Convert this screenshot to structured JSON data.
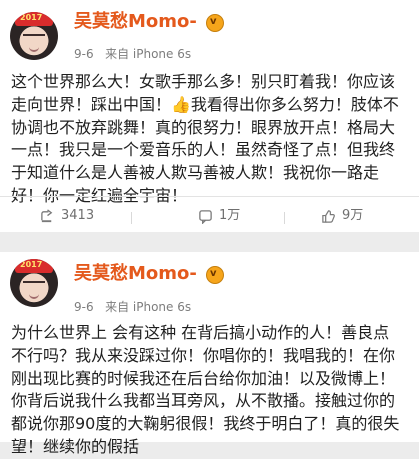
{
  "post1": {
    "user_name": "吴莫愁Momo-",
    "date": "9-6",
    "source": "来自 iPhone 6s",
    "text": "这个世界那么大！女歌手那么多！别只盯着我！你应该走向世界！踩出中国！👍我看得出你多么努力！肢体不协调也不放弃跳舞！真的很努力！眼界放开点！格局大一点！我只是一个爱音乐的人！虽然奇怪了点！但我终于知道什么是人善被人欺马善被人欺！我祝你一路走好！你一定红遍全宇宙！",
    "actions": {
      "share_count": "3413",
      "comment_count": "1万",
      "like_count": "9万"
    }
  },
  "post2": {
    "user_name": "吴莫愁Momo-",
    "date": "9-6",
    "source": "来自 iPhone 6s",
    "text": "为什么世界上 会有这种 在背后搞小动作的人！善良点不行吗？我从来没踩过你！你唱你的！我唱我的！在你刚出现比赛的时候我还在后台给你加油！以及微博上！你背后说我什么我都当耳旁风，从不散播。接触过你的都说你那90度的大鞠躬很假！我终于明白了！真的很失望！继续你的假括"
  },
  "colors": {
    "username": "#e4591c",
    "background": "#ececec",
    "card": "#ffffff"
  },
  "icons": {
    "share": "share-icon",
    "comment": "comment-icon",
    "like": "like-icon",
    "badge": "vip-badge-icon"
  }
}
